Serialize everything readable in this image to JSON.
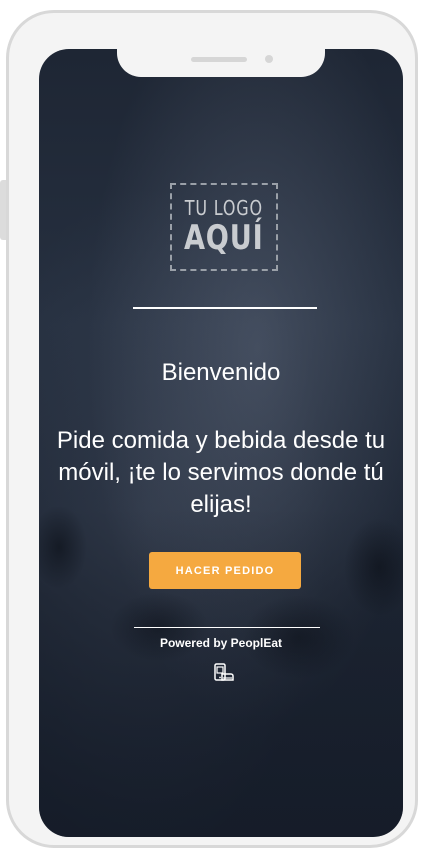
{
  "logo": {
    "line1": "TU LOGO",
    "line2": "AQUÍ"
  },
  "welcome": {
    "title": "Bienvenido",
    "tagline": "Pide comida y bebida desde tu móvil, ¡te lo servimos donde tú elijas!"
  },
  "actions": {
    "order_label": "HACER PEDIDO"
  },
  "footer": {
    "powered_by": "Powered by PeoplEat",
    "brand_icon": "peopleat-app-icon"
  },
  "colors": {
    "accent": "#f5a940",
    "background": "#1f2735",
    "text": "#ffffff"
  }
}
